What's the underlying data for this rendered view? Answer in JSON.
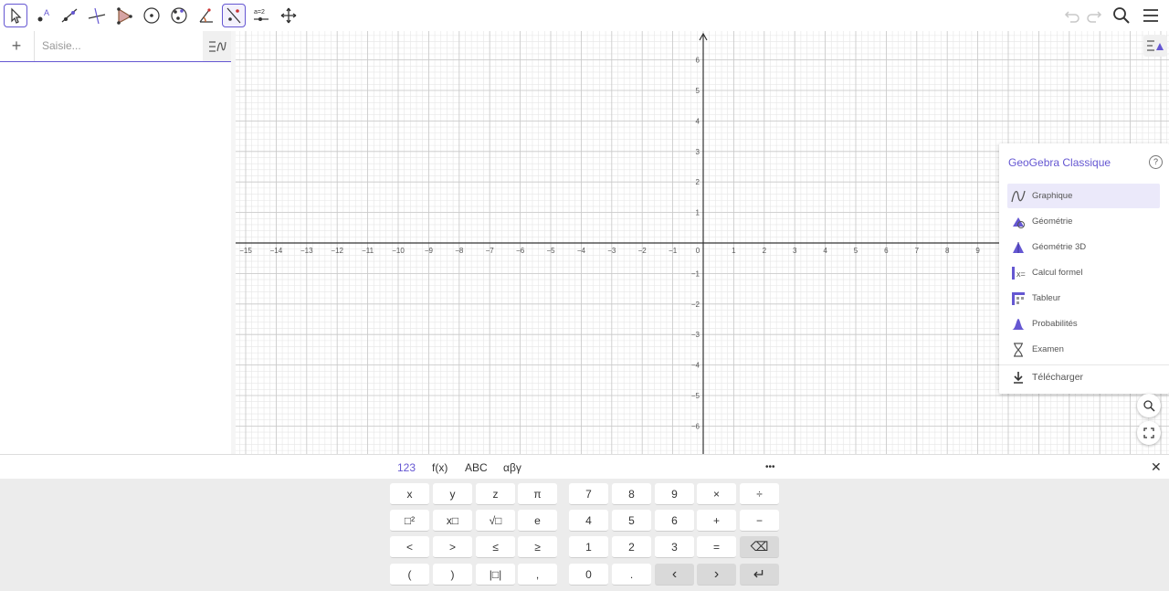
{
  "toolbar": {
    "tools": [
      "move",
      "point",
      "line",
      "perpendicular-line",
      "polygon",
      "circle",
      "conic",
      "angle",
      "reflect",
      "slider",
      "move-graphics"
    ],
    "slider_label": "a=2",
    "active_tool": "reflect"
  },
  "algebra": {
    "input_placeholder": "Saisie...",
    "add_label": "+"
  },
  "axes": {
    "x_ticks": [
      "−15",
      "−14",
      "−13",
      "−12",
      "−11",
      "−10",
      "−9",
      "−8",
      "−7",
      "−6",
      "−5",
      "−4",
      "−3",
      "−2",
      "−1",
      "0",
      "1",
      "2",
      "3",
      "4",
      "5",
      "6",
      "7",
      "8",
      "9"
    ],
    "y_ticks_pos": [
      "1",
      "2",
      "3",
      "4",
      "5",
      "6"
    ],
    "y_ticks_neg": [
      "−1",
      "−2",
      "−3",
      "−4",
      "−5",
      "−6"
    ]
  },
  "apps_panel": {
    "title": "GeoGebra Classique",
    "help_label": "?",
    "items": [
      {
        "label": "Graphique",
        "icon": "graphing-icon"
      },
      {
        "label": "Géométrie",
        "icon": "geometry-icon"
      },
      {
        "label": "Géométrie 3D",
        "icon": "3d-icon"
      },
      {
        "label": "Calcul formel",
        "icon": "cas-icon"
      },
      {
        "label": "Tableur",
        "icon": "spreadsheet-icon"
      },
      {
        "label": "Probabilités",
        "icon": "probability-icon"
      },
      {
        "label": "Examen",
        "icon": "exam-icon"
      }
    ],
    "download_label": "Télécharger"
  },
  "keyboard": {
    "tabs": [
      "123",
      "f(x)",
      "ABC",
      "αβγ"
    ],
    "more_label": "•••",
    "close_label": "✕",
    "left_keys": [
      [
        "x",
        "y",
        "z",
        "π"
      ],
      [
        "□²",
        "x□",
        "√□",
        "e"
      ],
      [
        "<",
        ">",
        "≤",
        "≥"
      ],
      [
        "(",
        ")",
        "|□|",
        ","
      ]
    ],
    "right_keys": [
      [
        "7",
        "8",
        "9",
        "×",
        "÷"
      ],
      [
        "4",
        "5",
        "6",
        "+",
        "−"
      ],
      [
        "1",
        "2",
        "3",
        "=",
        "⌫"
      ],
      [
        "0",
        ".",
        "‹",
        "›",
        "↵"
      ]
    ]
  },
  "colors": {
    "accent": "#6557d2",
    "grid_minor": "#e6e6e6",
    "grid_major": "#c8c8c8"
  }
}
